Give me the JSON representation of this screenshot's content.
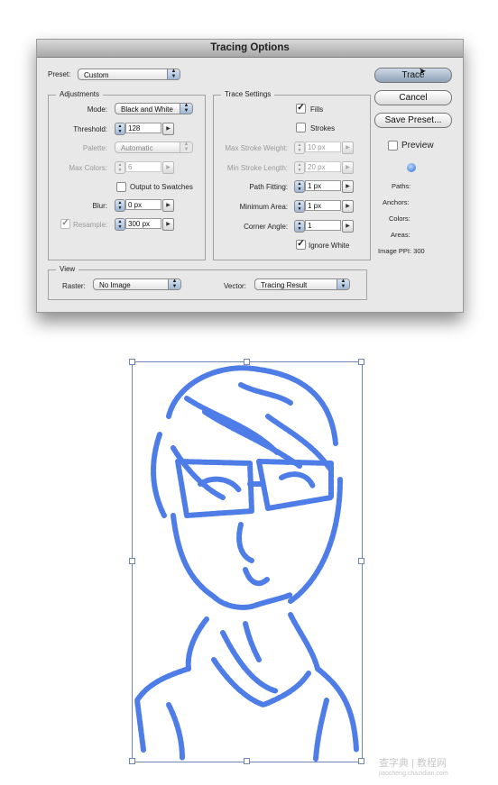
{
  "dialog": {
    "title": "Tracing Options",
    "preset": {
      "label": "Preset:",
      "value": "Custom"
    },
    "adjustments": {
      "legend": "Adjustments",
      "mode": {
        "label": "Mode:",
        "value": "Black and White"
      },
      "threshold": {
        "label": "Threshold:",
        "value": "128"
      },
      "palette": {
        "label": "Palette:",
        "value": "Automatic",
        "enabled": false
      },
      "max_colors": {
        "label": "Max Colors:",
        "value": "6",
        "enabled": false
      },
      "output_to_swatches": {
        "label": "Output to Swatches",
        "checked": false
      },
      "blur": {
        "label": "Blur:",
        "value": "0 px"
      },
      "resample": {
        "label": "Resample:",
        "value": "300 px",
        "checked": true
      }
    },
    "trace_settings": {
      "legend": "Trace Settings",
      "fills": {
        "label": "Fills",
        "checked": true
      },
      "strokes": {
        "label": "Strokes",
        "checked": false
      },
      "max_stroke_weight": {
        "label": "Max Stroke Weight:",
        "value": "10 px",
        "enabled": false
      },
      "min_stroke_length": {
        "label": "Min Stroke Length:",
        "value": "20 px",
        "enabled": false
      },
      "path_fitting": {
        "label": "Path Fitting:",
        "value": "1 px"
      },
      "minimum_area": {
        "label": "Minimum Area:",
        "value": "1 px"
      },
      "corner_angle": {
        "label": "Corner Angle:",
        "value": "1"
      },
      "ignore_white": {
        "label": "Ignore White",
        "checked": true
      }
    },
    "view": {
      "legend": "View",
      "raster": {
        "label": "Raster:",
        "value": "No Image"
      },
      "vector": {
        "label": "Vector:",
        "value": "Tracing Result"
      }
    },
    "buttons": {
      "trace": "Trace",
      "cancel": "Cancel",
      "save_preset": "Save Preset..."
    },
    "preview": {
      "label": "Preview",
      "checked": false
    },
    "info": {
      "icon": "info-icon",
      "paths": "Paths:",
      "anchors": "Anchors:",
      "colors": "Colors:",
      "areas": "Areas:",
      "image_ppi": "Image PPI: 300"
    }
  },
  "artwork": {
    "description": "Traced sketch of a person with glasses (vector tracing result)",
    "fill_color": "#4f7de8",
    "outline_color": "#000000",
    "selection_color": "#6f86b5"
  },
  "watermark": {
    "line1": "查字典 | 教程网",
    "line2": "jiaocheng.chazidian.com"
  }
}
